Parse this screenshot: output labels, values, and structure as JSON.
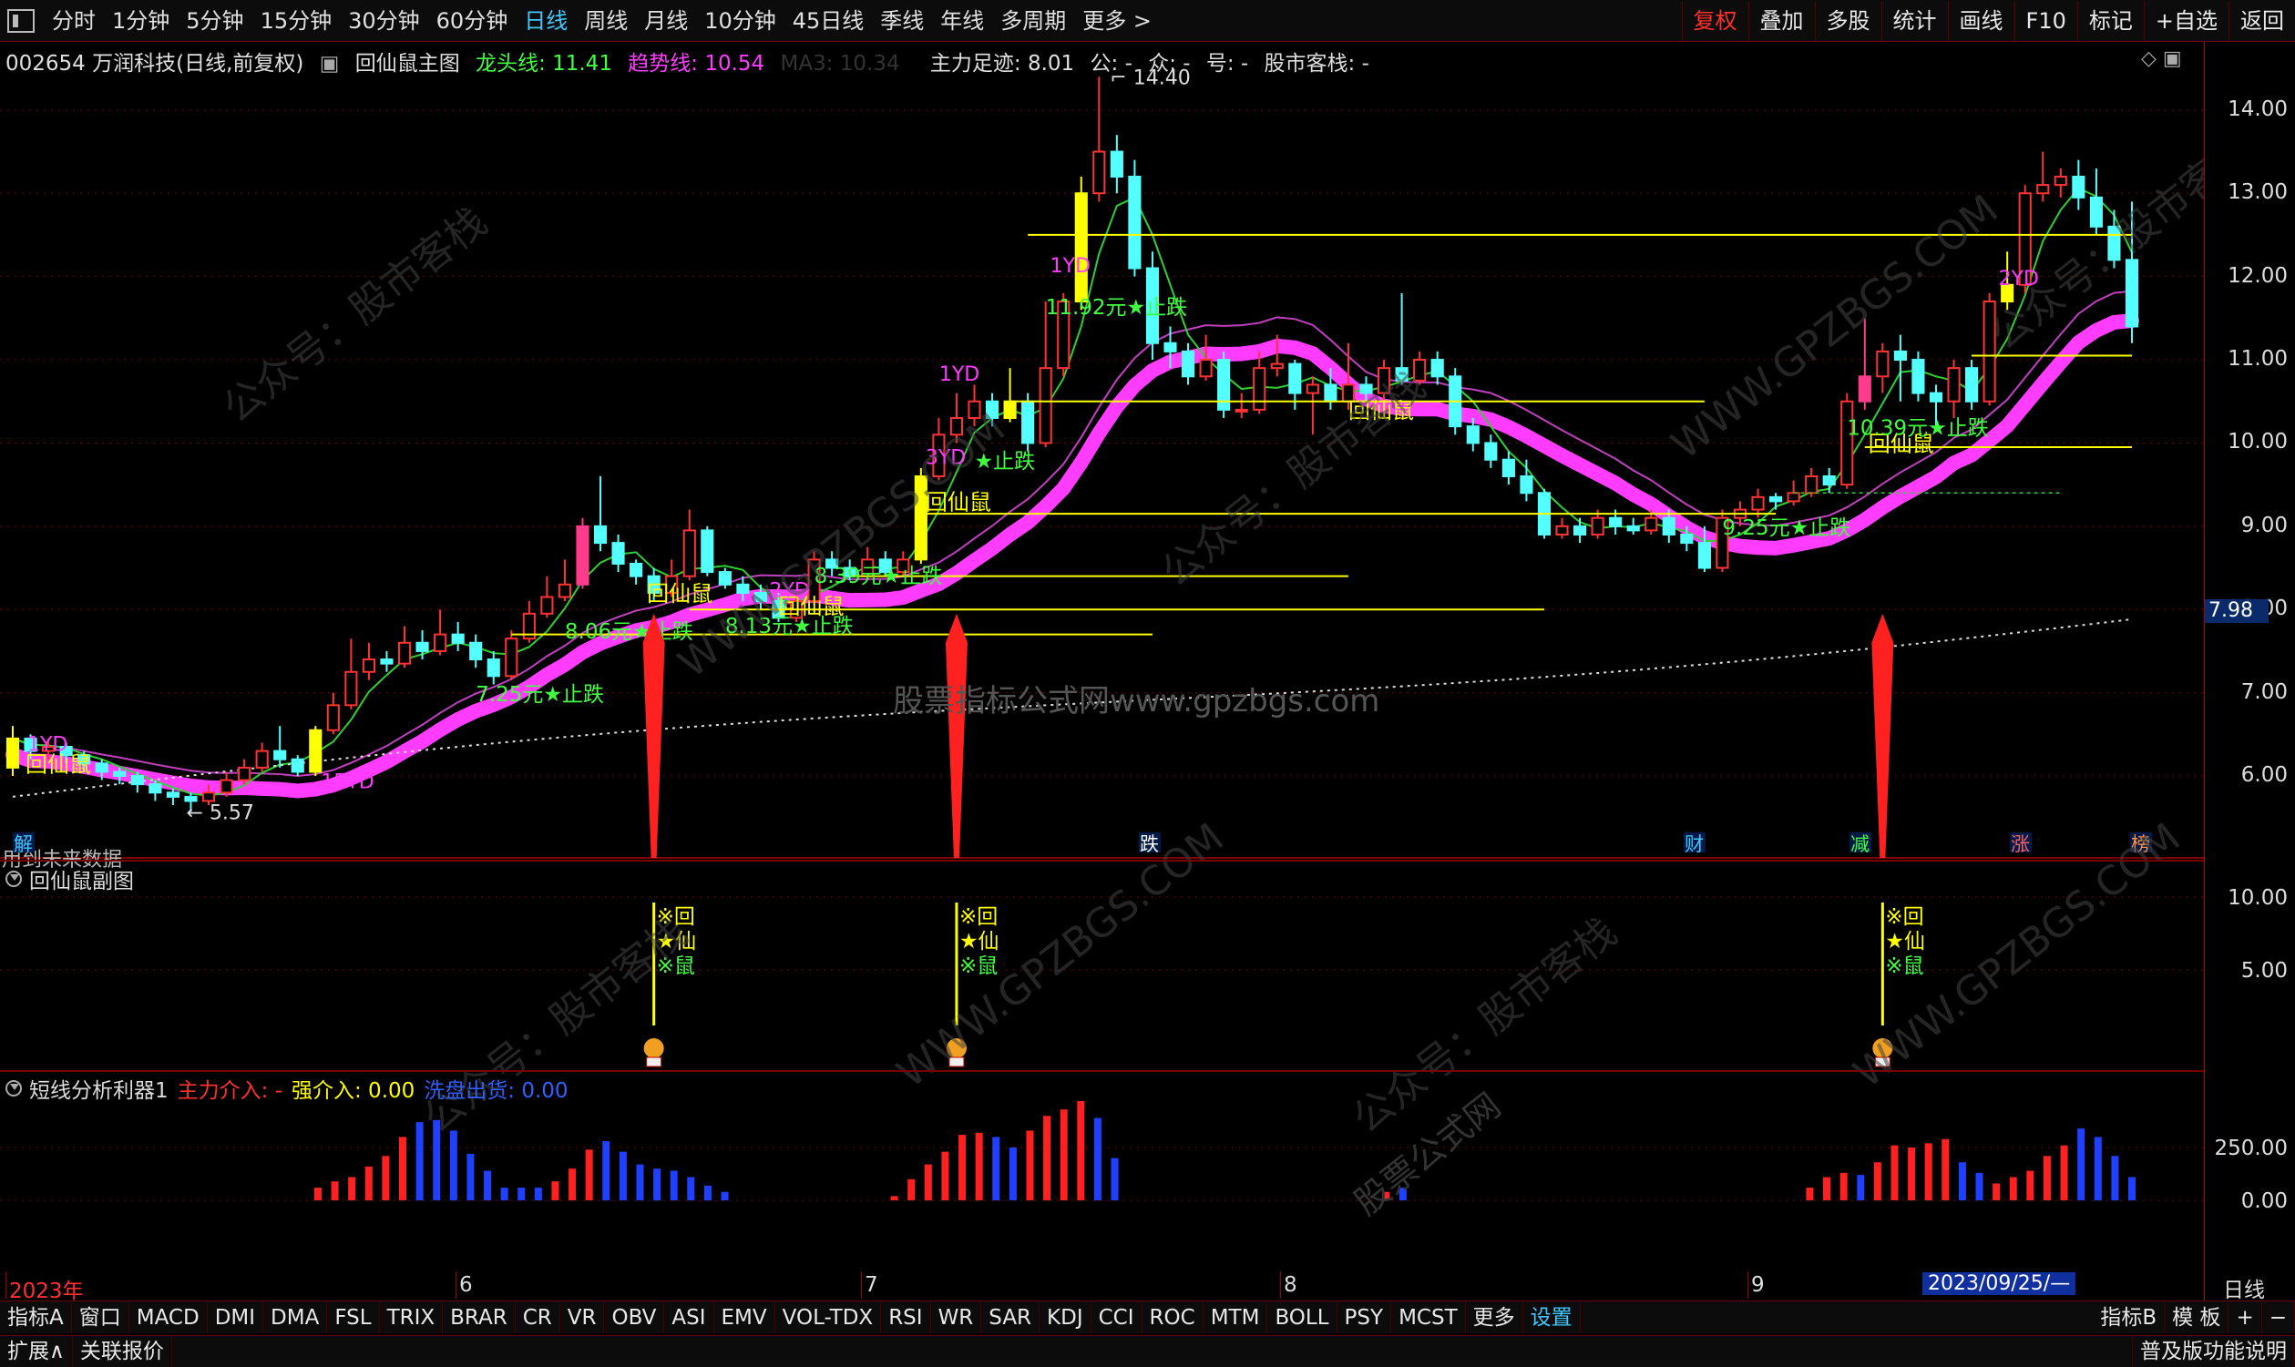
{
  "toolbar": {
    "periods": [
      "分时",
      "1分钟",
      "5分钟",
      "15分钟",
      "30分钟",
      "60分钟",
      "日线",
      "周线",
      "月线",
      "10分钟",
      "45日线",
      "季线",
      "年线",
      "多周期",
      "更多 >"
    ],
    "active_period": "日线",
    "right_buttons": [
      "复权",
      "叠加",
      "多股",
      "统计",
      "画线",
      "F10",
      "标记",
      "+自选",
      "返回"
    ],
    "active_right": "复权"
  },
  "main_legend": {
    "stock": "002654 万润科技(日线,前复权)",
    "indicator": "回仙鼠主图",
    "longtou_label": "龙头线: 11.41",
    "trend_label": "趋势线: 10.54",
    "ma3_label": "MA3: 10.34",
    "zhuli_label": "主力足迹: 8.01",
    "gong_label": "公: -",
    "zhong_label": "众: -",
    "hao_label": "号: -",
    "gushi_label": "股市客栈: -"
  },
  "price_axis": {
    "ticks": [
      "14.00",
      "13.00",
      "12.00",
      "11.00",
      "10.00",
      "9.00",
      "8.00",
      "7.00",
      "6.00"
    ],
    "current_price": "7.98"
  },
  "sub_axis": {
    "ticks": [
      "10.00",
      "5.00"
    ]
  },
  "osc_axis": {
    "ticks": [
      "250.00",
      "0.00"
    ]
  },
  "sub_legend": {
    "title": "回仙鼠副图"
  },
  "osc_legend": {
    "title": "短线分析利器1",
    "zhuli": "主力介入: -",
    "qiang": "强介入: 0.00",
    "xipan": "洗盘出货: 0.00"
  },
  "chart_labels": {
    "high": "14.40",
    "low": "5.57",
    "no_data": "用到未来数据",
    "huixianshu": "回仙鼠",
    "stops": [
      "7.25元★止跌",
      "8.06元★止跌",
      "8.13元★止跌",
      "8.39元★止跌",
      "11.92元★止跌",
      "9.25元★止跌",
      "10.39元★止跌",
      "★止跌"
    ],
    "yd": [
      "1YD",
      "15YD",
      "1YD",
      "1YD",
      "2YD",
      "3YD",
      "2YD"
    ],
    "events": [
      "解",
      "跌",
      "财",
      "减",
      "涨",
      "榜"
    ],
    "sub_marks": [
      "※回",
      "★仙",
      "※鼠"
    ],
    "watermarks": [
      "公众号：股市客栈",
      "WWW.GPZBGS.COM",
      "股票指标公式网www.gpzbgs.com",
      "股票公式网"
    ]
  },
  "x_axis": {
    "labels": [
      "2023年",
      "6",
      "7",
      "8",
      "9"
    ],
    "cursor_date": "2023/09/25/—",
    "period": "日线"
  },
  "bottom_tabs": [
    "指标A",
    "窗口",
    "MACD",
    "DMI",
    "DMA",
    "FSL",
    "TRIX",
    "BRAR",
    "CR",
    "VR",
    "OBV",
    "ASI",
    "EMV",
    "VOL-TDX",
    "RSI",
    "WR",
    "SAR",
    "KDJ",
    "CCI",
    "ROC",
    "MTM",
    "BOLL",
    "PSY",
    "MCST",
    "更多",
    "设置"
  ],
  "bottom_right": [
    "指标B",
    "模 板",
    "+",
    "−"
  ],
  "bottom_row2": {
    "left": [
      "扩展∧",
      "关联报价"
    ],
    "right": "普及版功能说明"
  },
  "colors": {
    "up": "#ff3333",
    "down": "#54ffff",
    "yellow": "#ffff00",
    "magenta": "#ff3cff",
    "green": "#40ff40",
    "blue": "#2020ff",
    "grid": "#7a0000"
  },
  "chart_data": {
    "type": "candlestick",
    "price_ylim": [
      5.3,
      14.6
    ],
    "candles": [
      [
        6.1,
        6.45,
        6.6,
        6.0
      ],
      [
        6.45,
        6.3,
        6.5,
        6.2
      ],
      [
        6.3,
        6.35,
        6.45,
        6.2
      ],
      [
        6.35,
        6.25,
        6.4,
        6.15
      ],
      [
        6.25,
        6.15,
        6.3,
        6.05
      ],
      [
        6.15,
        6.05,
        6.2,
        5.95
      ],
      [
        6.05,
        6.0,
        6.1,
        5.9
      ],
      [
        6.0,
        5.9,
        6.05,
        5.8
      ],
      [
        5.9,
        5.8,
        5.95,
        5.7
      ],
      [
        5.8,
        5.75,
        5.85,
        5.65
      ],
      [
        5.75,
        5.7,
        5.8,
        5.57
      ],
      [
        5.7,
        5.8,
        5.9,
        5.65
      ],
      [
        5.8,
        5.95,
        6.05,
        5.75
      ],
      [
        5.95,
        6.1,
        6.2,
        5.9
      ],
      [
        6.1,
        6.3,
        6.4,
        6.05
      ],
      [
        6.3,
        6.2,
        6.6,
        6.1
      ],
      [
        6.2,
        6.05,
        6.25,
        6.0
      ],
      [
        6.05,
        6.55,
        6.6,
        6.0
      ],
      [
        6.55,
        6.85,
        7.0,
        6.5
      ],
      [
        6.85,
        7.25,
        7.65,
        6.8
      ],
      [
        7.25,
        7.4,
        7.6,
        7.15
      ],
      [
        7.4,
        7.35,
        7.5,
        7.25
      ],
      [
        7.35,
        7.6,
        7.8,
        7.3
      ],
      [
        7.6,
        7.5,
        7.75,
        7.4
      ],
      [
        7.5,
        7.7,
        8.0,
        7.45
      ],
      [
        7.7,
        7.6,
        7.85,
        7.5
      ],
      [
        7.6,
        7.4,
        7.7,
        7.3
      ],
      [
        7.4,
        7.2,
        7.5,
        7.1
      ],
      [
        7.2,
        7.65,
        7.75,
        7.15
      ],
      [
        7.65,
        7.95,
        8.1,
        7.6
      ],
      [
        7.95,
        8.15,
        8.4,
        7.9
      ],
      [
        8.15,
        8.3,
        8.6,
        8.1
      ],
      [
        8.3,
        9.0,
        9.1,
        8.25
      ],
      [
        9.0,
        8.8,
        9.6,
        8.7
      ],
      [
        8.8,
        8.55,
        8.9,
        8.45
      ],
      [
        8.55,
        8.4,
        8.6,
        8.3
      ],
      [
        8.4,
        8.2,
        8.5,
        8.1
      ],
      [
        8.2,
        8.4,
        8.6,
        8.15
      ],
      [
        8.4,
        8.95,
        9.2,
        8.35
      ],
      [
        8.95,
        8.45,
        9.0,
        8.4
      ],
      [
        8.45,
        8.3,
        8.5,
        8.25
      ],
      [
        8.3,
        8.2,
        8.4,
        8.1
      ],
      [
        8.2,
        8.1,
        8.3,
        8.0
      ],
      [
        8.1,
        7.9,
        8.2,
        7.85
      ],
      [
        7.9,
        8.1,
        8.2,
        7.85
      ],
      [
        8.1,
        8.6,
        8.7,
        8.05
      ],
      [
        8.6,
        8.5,
        8.7,
        8.4
      ],
      [
        8.5,
        8.4,
        8.6,
        8.35
      ],
      [
        8.4,
        8.6,
        8.75,
        8.35
      ],
      [
        8.6,
        8.45,
        8.7,
        8.4
      ],
      [
        8.45,
        8.6,
        8.7,
        8.4
      ],
      [
        8.6,
        9.6,
        9.7,
        8.55
      ],
      [
        9.6,
        10.1,
        10.3,
        9.55
      ],
      [
        10.1,
        10.3,
        10.6,
        10.0
      ],
      [
        10.3,
        10.5,
        10.7,
        10.2
      ],
      [
        10.5,
        10.3,
        10.6,
        10.2
      ],
      [
        10.3,
        10.5,
        10.9,
        10.25
      ],
      [
        10.5,
        10.0,
        10.6,
        9.9
      ],
      [
        10.0,
        10.9,
        11.7,
        9.95
      ],
      [
        10.9,
        11.7,
        11.8,
        10.8
      ],
      [
        11.7,
        13.0,
        13.2,
        11.6
      ],
      [
        13.0,
        13.5,
        14.4,
        12.9
      ],
      [
        13.5,
        13.2,
        13.7,
        13.0
      ],
      [
        13.2,
        12.1,
        13.4,
        12.0
      ],
      [
        12.1,
        11.2,
        12.3,
        11.0
      ],
      [
        11.2,
        11.1,
        11.4,
        10.9
      ],
      [
        11.1,
        10.8,
        11.2,
        10.7
      ],
      [
        10.8,
        11.0,
        11.3,
        10.75
      ],
      [
        11.0,
        10.4,
        11.1,
        10.3
      ],
      [
        10.4,
        10.4,
        10.6,
        10.3
      ],
      [
        10.4,
        10.9,
        11.1,
        10.35
      ],
      [
        10.9,
        10.95,
        11.3,
        10.8
      ],
      [
        10.95,
        10.6,
        11.0,
        10.4
      ],
      [
        10.6,
        10.7,
        10.8,
        10.1
      ],
      [
        10.7,
        10.5,
        10.9,
        10.4
      ],
      [
        10.5,
        10.7,
        11.2,
        10.4
      ],
      [
        10.7,
        10.6,
        10.8,
        10.5
      ],
      [
        10.6,
        10.9,
        11.0,
        10.5
      ],
      [
        10.9,
        10.75,
        11.8,
        10.7
      ],
      [
        10.75,
        11.0,
        11.1,
        10.7
      ],
      [
        11.0,
        10.8,
        11.1,
        10.7
      ],
      [
        10.8,
        10.2,
        10.9,
        10.1
      ],
      [
        10.2,
        10.0,
        10.3,
        9.9
      ],
      [
        10.0,
        9.8,
        10.1,
        9.7
      ],
      [
        9.8,
        9.6,
        9.9,
        9.5
      ],
      [
        9.6,
        9.4,
        9.8,
        9.3
      ],
      [
        9.4,
        8.9,
        9.45,
        8.85
      ],
      [
        8.9,
        9.0,
        9.1,
        8.85
      ],
      [
        9.0,
        8.9,
        9.1,
        8.8
      ],
      [
        8.9,
        9.1,
        9.2,
        8.85
      ],
      [
        9.1,
        9.0,
        9.2,
        8.9
      ],
      [
        9.0,
        8.95,
        9.1,
        8.9
      ],
      [
        8.95,
        9.1,
        9.2,
        8.9
      ],
      [
        9.1,
        8.9,
        9.2,
        8.8
      ],
      [
        8.9,
        8.8,
        9.0,
        8.7
      ],
      [
        8.8,
        8.5,
        9.0,
        8.45
      ],
      [
        8.5,
        9.1,
        9.2,
        8.45
      ],
      [
        9.1,
        9.2,
        9.3,
        9.0
      ],
      [
        9.2,
        9.35,
        9.45,
        9.1
      ],
      [
        9.35,
        9.3,
        9.4,
        9.2
      ],
      [
        9.3,
        9.4,
        9.55,
        9.25
      ],
      [
        9.4,
        9.6,
        9.7,
        9.35
      ],
      [
        9.6,
        9.5,
        9.7,
        9.4
      ],
      [
        9.5,
        10.5,
        10.6,
        9.45
      ],
      [
        10.5,
        10.8,
        11.5,
        10.4
      ],
      [
        10.8,
        11.1,
        11.2,
        10.6
      ],
      [
        11.1,
        11.0,
        11.3,
        10.5
      ],
      [
        11.0,
        10.6,
        11.1,
        10.5
      ],
      [
        10.6,
        10.5,
        10.7,
        10.2
      ],
      [
        10.5,
        10.9,
        11.0,
        10.3
      ],
      [
        10.9,
        10.5,
        11.0,
        10.4
      ],
      [
        10.5,
        11.7,
        11.8,
        10.45
      ],
      [
        11.7,
        11.9,
        12.3,
        11.6
      ],
      [
        11.9,
        13.0,
        13.1,
        11.8
      ],
      [
        13.0,
        13.1,
        13.5,
        12.9
      ],
      [
        13.1,
        13.2,
        13.3,
        12.95
      ],
      [
        13.2,
        12.95,
        13.4,
        12.8
      ],
      [
        12.95,
        12.6,
        13.3,
        12.5
      ],
      [
        12.6,
        12.2,
        12.8,
        12.1
      ],
      [
        12.2,
        11.4,
        12.9,
        11.2
      ]
    ],
    "osc_values": [
      0,
      0,
      0,
      0,
      0,
      0,
      0,
      0,
      0,
      0,
      0,
      0,
      0,
      0,
      0,
      0,
      0,
      0,
      60,
      90,
      110,
      160,
      210,
      300,
      370,
      380,
      330,
      220,
      140,
      60,
      60,
      60,
      90,
      150,
      240,
      280,
      230,
      170,
      150,
      140,
      110,
      70,
      40,
      0,
      0,
      0,
      0,
      0,
      0,
      0,
      0,
      0,
      20,
      100,
      170,
      230,
      310,
      320,
      300,
      250,
      330,
      400,
      430,
      470,
      390,
      200,
      0,
      0,
      0,
      0,
      0,
      0,
      0,
      0,
      0,
      0,
      0,
      0,
      0,
      0,
      0,
      40,
      60,
      0,
      0,
      0,
      0,
      0,
      0,
      0,
      0,
      0,
      0,
      0,
      0,
      0,
      0,
      0,
      0,
      0,
      0,
      0,
      0,
      0,
      0,
      0,
      60,
      110,
      130,
      120,
      180,
      260,
      250,
      270,
      290,
      180,
      130,
      80,
      110,
      140,
      210,
      260,
      340,
      300,
      210,
      110
    ],
    "osc_colors": [
      "r",
      "r",
      "r",
      "r",
      "r",
      "r",
      "r",
      "r",
      "r",
      "r",
      "r",
      "r",
      "r",
      "r",
      "r",
      "r",
      "r",
      "r",
      "r",
      "r",
      "r",
      "r",
      "r",
      "r",
      "b",
      "b",
      "b",
      "b",
      "b",
      "b",
      "b",
      "b",
      "r",
      "r",
      "r",
      "b",
      "b",
      "b",
      "b",
      "b",
      "b",
      "b",
      "b",
      "b",
      "b",
      "b",
      "b",
      "b",
      "b",
      "b",
      "b",
      "b",
      "r",
      "r",
      "r",
      "r",
      "r",
      "r",
      "b",
      "b",
      "r",
      "r",
      "r",
      "r",
      "b",
      "b",
      "b",
      "b",
      "b",
      "b",
      "b",
      "b",
      "b",
      "b",
      "b",
      "b",
      "b",
      "b",
      "b",
      "b",
      "b",
      "r",
      "b",
      "b",
      "b",
      "b",
      "b",
      "b",
      "b",
      "b",
      "b",
      "b",
      "b",
      "b",
      "b",
      "b",
      "b",
      "b",
      "b",
      "b",
      "b",
      "b",
      "b",
      "b",
      "b",
      "b",
      "r",
      "r",
      "r",
      "b",
      "r",
      "r",
      "r",
      "r",
      "r",
      "b",
      "b",
      "r",
      "r",
      "r",
      "r",
      "r",
      "b",
      "b",
      "b",
      "b"
    ]
  }
}
